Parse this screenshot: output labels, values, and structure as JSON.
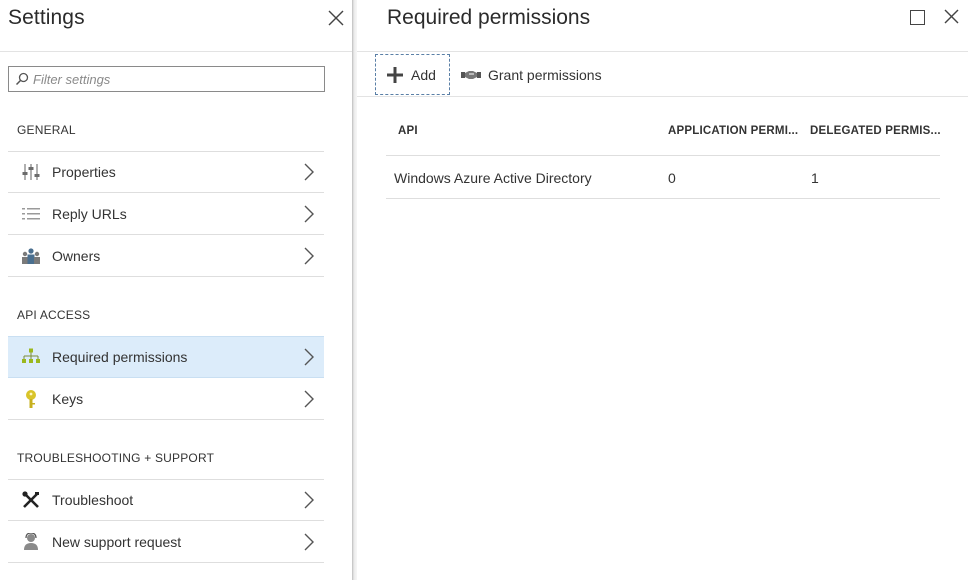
{
  "settings_blade": {
    "title": "Settings",
    "filter_placeholder": "Filter settings",
    "sections": [
      {
        "label": "GENERAL",
        "items": [
          {
            "label": "Properties",
            "icon": "properties-icon"
          },
          {
            "label": "Reply URLs",
            "icon": "list-icon"
          },
          {
            "label": "Owners",
            "icon": "owners-icon"
          }
        ]
      },
      {
        "label": "API ACCESS",
        "items": [
          {
            "label": "Required permissions",
            "icon": "permissions-hierarchy-icon",
            "selected": true
          },
          {
            "label": "Keys",
            "icon": "key-icon"
          }
        ]
      },
      {
        "label": "TROUBLESHOOTING + SUPPORT",
        "items": [
          {
            "label": "Troubleshoot",
            "icon": "troubleshoot-tools-icon"
          },
          {
            "label": "New support request",
            "icon": "support-person-icon"
          }
        ]
      }
    ]
  },
  "permissions_blade": {
    "title": "Required permissions",
    "toolbar": {
      "add_label": "Add",
      "grant_label": "Grant permissions"
    },
    "table": {
      "columns": [
        "API",
        "APPLICATION PERMI...",
        "DELEGATED PERMIS..."
      ],
      "rows": [
        [
          "Windows Azure Active Directory",
          "0",
          "1"
        ]
      ]
    }
  },
  "colors": {
    "selected_bg": "#dcecfa",
    "accent_border": "#5a7fa6",
    "key_yellow": "#d9c42a",
    "permissions_green": "#9bb81d"
  }
}
